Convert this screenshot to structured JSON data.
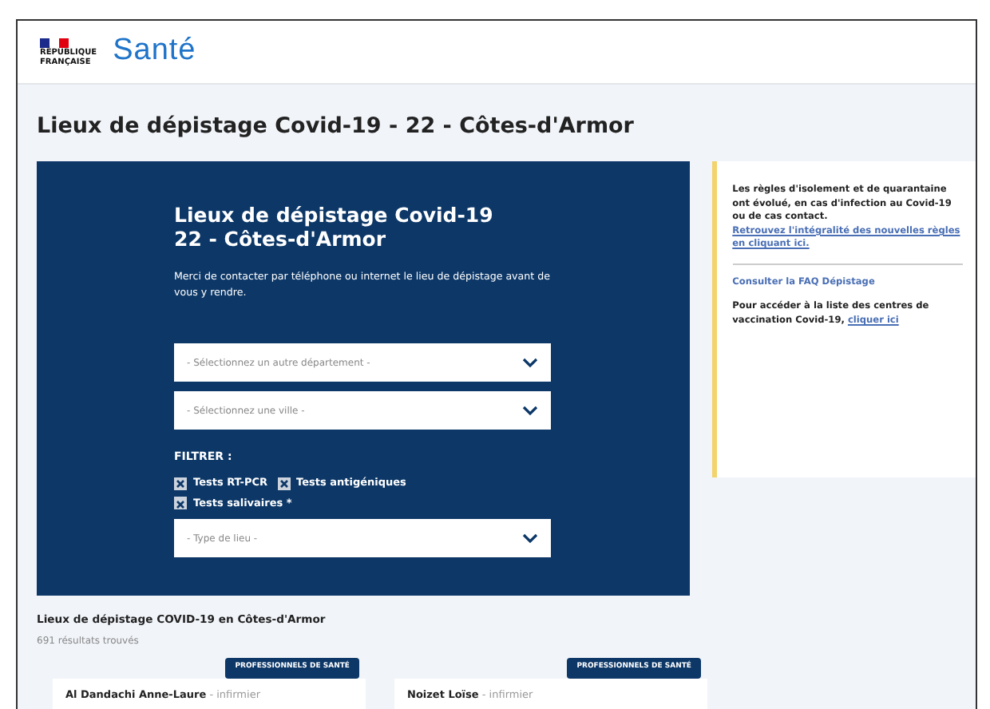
{
  "header": {
    "republic_lines": [
      "RÉPUBLIQUE",
      "FRANÇAISE"
    ],
    "brand": "Santé"
  },
  "page_title": "Lieux de dépistage Covid-19 - 22 - Côtes-d'Armor",
  "panel": {
    "title_lines": [
      "Lieux de dépistage Covid-19",
      "22 - Côtes-d'Armor"
    ],
    "note": "Merci de contacter par téléphone ou internet le lieu de dépistage avant de vous y rendre.",
    "selects": [
      {
        "placeholder": "- Sélectionnez un autre département -"
      },
      {
        "placeholder": "- Sélectionnez une ville -"
      }
    ],
    "filter_label": "FILTRER :",
    "filters": [
      {
        "label": "Tests RT-PCR",
        "checked": true
      },
      {
        "label": "Tests antigéniques",
        "checked": true
      },
      {
        "label": "Tests salivaires *",
        "checked": true
      }
    ],
    "type_select": {
      "placeholder": "- Type de lieu -"
    }
  },
  "sidebar": {
    "notice": {
      "text": "Les règles d'isolement et de quarantaine ont évolué, en cas d'infection au Covid-19 ou de cas contact.",
      "link": "Retrouvez l'intégralité des nouvelles règles en cliquant ici."
    },
    "faq_link": "Consulter la FAQ Dépistage",
    "vaccination": {
      "text": "Pour accéder à la liste des centres de vaccination Covid-19,",
      "link": "cliquer ici"
    }
  },
  "results": {
    "heading": "Lieux de dépistage COVID-19 en Côtes-d'Armor",
    "count": "691 résultats trouvés",
    "cards": [
      {
        "badge": "PROFESSIONNELS DE SANTÉ",
        "name": "Al Dandachi Anne-Laure",
        "role": "- infirmier"
      },
      {
        "badge": "PROFESSIONNELS DE SANTÉ",
        "name": "Noizet Loïse",
        "role": "- infirmier"
      }
    ]
  }
}
